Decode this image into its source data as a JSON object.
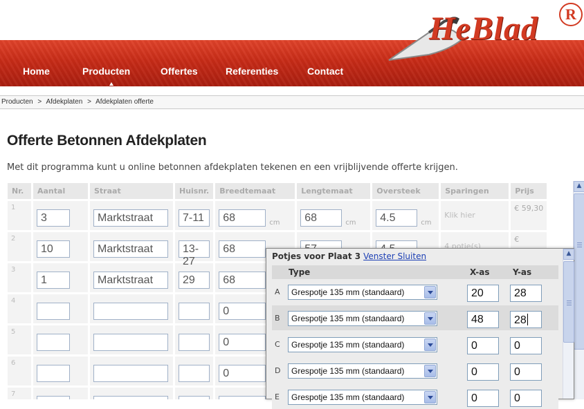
{
  "brand": {
    "logo_text": "HeBlad",
    "reg_mark": "R"
  },
  "nav": {
    "items": [
      "Home",
      "Producten",
      "Offertes",
      "Referenties",
      "Contact"
    ],
    "active": "Producten"
  },
  "breadcrumb": [
    "Producten",
    ">",
    "Afdekplaten",
    ">",
    "Afdekplaten offerte"
  ],
  "page": {
    "title": "Offerte Betonnen Afdekplaten",
    "intro": "Met dit programma kunt u online betonnen afdekplaten tekenen en een vrijblijvende offerte krijgen."
  },
  "table": {
    "headers": [
      "Nr.",
      "Aantal",
      "Straat",
      "Huisnr.",
      "Breedtemaat",
      "Lengtemaat",
      "Oversteek",
      "Sparingen",
      "Prijs"
    ],
    "unit": "cm",
    "rows": [
      {
        "nr": "1",
        "aantal": "3",
        "straat": "Marktstraat",
        "huisnr": "7-11",
        "breedte": "68",
        "lengte": "68",
        "oversteek": "4.5",
        "sparingen": "Klik hier",
        "prijs": "€ 59,30"
      },
      {
        "nr": "2",
        "aantal": "10",
        "straat": "Marktstraat",
        "huisnr": "13-27",
        "breedte": "68",
        "lengte": "57",
        "oversteek": "4.5",
        "sparingen": "4 potje(s)",
        "prijs": "€"
      },
      {
        "nr": "3",
        "aantal": "1",
        "straat": "Marktstraat",
        "huisnr": "29",
        "breedte": "68",
        "lengte": "",
        "oversteek": "",
        "sparingen": "",
        "prijs": ""
      },
      {
        "nr": "4",
        "aantal": "",
        "straat": "",
        "huisnr": "",
        "breedte": "0",
        "lengte": "",
        "oversteek": "",
        "sparingen": "",
        "prijs": ""
      },
      {
        "nr": "5",
        "aantal": "",
        "straat": "",
        "huisnr": "",
        "breedte": "0",
        "lengte": "",
        "oversteek": "",
        "sparingen": "",
        "prijs": ""
      },
      {
        "nr": "6",
        "aantal": "",
        "straat": "",
        "huisnr": "",
        "breedte": "0",
        "lengte": "",
        "oversteek": "",
        "sparingen": "",
        "prijs": ""
      },
      {
        "nr": "7",
        "aantal": "",
        "straat": "",
        "huisnr": "",
        "breedte": "0",
        "lengte": "",
        "oversteek": "",
        "sparingen": "",
        "prijs": ""
      }
    ]
  },
  "popup": {
    "title": "Potjes voor Plaat 3",
    "close_label": "Venster Sluiten",
    "col_type": "Type",
    "col_x": "X-as",
    "col_y": "Y-as",
    "rows": [
      {
        "letter": "A",
        "type": "Grespotje 135 mm (standaard)",
        "x": "20",
        "y": "28"
      },
      {
        "letter": "B",
        "type": "Grespotje 135 mm (standaard)",
        "x": "48",
        "y": "28"
      },
      {
        "letter": "C",
        "type": "Grespotje 135 mm (standaard)",
        "x": "0",
        "y": "0"
      },
      {
        "letter": "D",
        "type": "Grespotje 135 mm (standaard)",
        "x": "0",
        "y": "0"
      },
      {
        "letter": "E",
        "type": "Grespotje 135 mm (standaard)",
        "x": "0",
        "y": "0"
      }
    ]
  },
  "icons": {
    "scroll_up": "arrow-up-icon",
    "dropdown": "chevron-down-icon",
    "trowel": "trowel-icon"
  },
  "colors": {
    "brand_red": "#c72b17",
    "link_blue": "#1c3fb4"
  }
}
